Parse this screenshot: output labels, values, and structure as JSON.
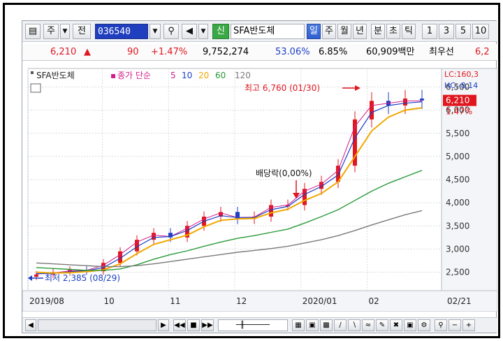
{
  "toolbar": {
    "market_label": "주",
    "jeon_label": "전",
    "stock_code": "036540",
    "sin_label": "신",
    "stock_name": "SFA반도체",
    "periods": [
      "일",
      "주",
      "월",
      "년",
      "분",
      "초",
      "틱"
    ],
    "active_period": "일",
    "numbers": [
      "1",
      "3",
      "5",
      "10"
    ]
  },
  "quote": {
    "price": "6,210",
    "change": "90",
    "change_pct": "+1.47%",
    "volume": "9,752,274",
    "vol_ratio": "53.06%",
    "turnover": "6.85%",
    "trade_value": "60,909백만",
    "extra_label": "최우선",
    "extra_value": "6,2"
  },
  "legend": {
    "stock_name": "SFA반도체",
    "series_label": "종가 단순",
    "ma_periods": [
      "5",
      "10",
      "20",
      "60",
      "120"
    ],
    "lc": "LC:160,3",
    "hc": "HC:-8,14"
  },
  "annotations": {
    "high_label": "최고 6,760 (01/30)",
    "low_label": "최저 2,385 (08/29)",
    "dividend_label": "배당락(0,00%)",
    "price_box": "6,210",
    "pct_label": "1.47%"
  },
  "x_ticks": [
    "2019/08",
    "10",
    "11",
    "12",
    "2020/01",
    "02",
    "02/21"
  ],
  "colors": {
    "up": "#e0171f",
    "down": "#1d3fc4",
    "ma5": "#d11e8c",
    "ma10": "#1d3fc4",
    "ma20": "#f0a800",
    "ma60": "#2a9a3a",
    "ma120": "#7a7a7a"
  },
  "chart_data": {
    "type": "line",
    "title": "",
    "xlabel": "",
    "ylabel": "",
    "y_ticks": [
      2500,
      3000,
      3500,
      4000,
      4500,
      5000,
      5500,
      6000,
      6500
    ],
    "ylim": [
      2100,
      6900
    ],
    "grid": true,
    "series": [
      {
        "name": "종가",
        "values": [
          2450,
          2500,
          2550,
          2520,
          2700,
          2950,
          3200,
          3350,
          3250,
          3500,
          3700,
          3800,
          3650,
          3700,
          3950,
          3950,
          4300,
          4450,
          4800,
          5800,
          6200,
          6100,
          6250,
          6210
        ]
      },
      {
        "name": "5",
        "values": [
          2460,
          2480,
          2530,
          2540,
          2650,
          2880,
          3150,
          3300,
          3270,
          3450,
          3650,
          3780,
          3680,
          3690,
          3900,
          3950,
          4250,
          4400,
          4700,
          5650,
          6100,
          6150,
          6200,
          6200
        ]
      },
      {
        "name": "10",
        "values": [
          2470,
          2470,
          2510,
          2530,
          2600,
          2800,
          3050,
          3250,
          3270,
          3400,
          3600,
          3720,
          3680,
          3680,
          3850,
          3920,
          4180,
          4350,
          4600,
          5400,
          5950,
          6100,
          6150,
          6180
        ]
      },
      {
        "name": "20",
        "values": [
          2500,
          2480,
          2490,
          2510,
          2550,
          2680,
          2900,
          3100,
          3200,
          3300,
          3480,
          3620,
          3650,
          3660,
          3780,
          3860,
          4050,
          4200,
          4450,
          5000,
          5550,
          5850,
          6000,
          6050
        ]
      },
      {
        "name": "60",
        "values": [
          2600,
          2580,
          2560,
          2540,
          2540,
          2570,
          2660,
          2780,
          2880,
          2960,
          3060,
          3150,
          3230,
          3290,
          3360,
          3430,
          3560,
          3700,
          3850,
          4050,
          4250,
          4420,
          4560,
          4700
        ]
      },
      {
        "name": "120",
        "values": [
          2700,
          2680,
          2660,
          2640,
          2620,
          2620,
          2640,
          2680,
          2730,
          2780,
          2830,
          2880,
          2930,
          2970,
          3010,
          3060,
          3130,
          3200,
          3290,
          3400,
          3520,
          3630,
          3740,
          3830
        ]
      }
    ],
    "legend": "top-left"
  }
}
